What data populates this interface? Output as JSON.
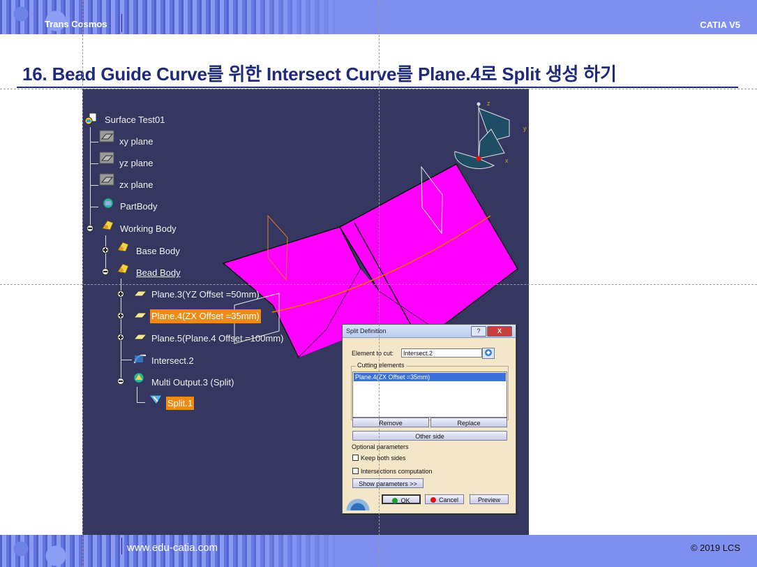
{
  "header": {
    "brand": "Trans Cosmos",
    "product": "CATIA V5"
  },
  "slide": {
    "title": "16. Bead Guide Curve를 위한 Intersect Curve를 Plane.4로 Split 생성 하기"
  },
  "footer": {
    "url": "www.edu-catia.com",
    "copyright": "© 2019 LCS"
  },
  "tree": {
    "root": "Surface Test01",
    "items": [
      {
        "label": "xy plane"
      },
      {
        "label": "yz plane"
      },
      {
        "label": "zx plane"
      },
      {
        "label": "PartBody"
      },
      {
        "label": "Working Body"
      },
      {
        "label": "Base Body"
      },
      {
        "label": "Bead Body"
      },
      {
        "label": "Plane.3(YZ Offset =50mm)"
      },
      {
        "label": "Plane.4(ZX Offset =35mm)"
      },
      {
        "label": "Plane.5(Plane.4 Offset =100mm)"
      },
      {
        "label": "Intersect.2"
      },
      {
        "label": "Multi Output.3 (Split)"
      },
      {
        "label": "Split.1"
      }
    ]
  },
  "compass": {
    "z": "z",
    "y": "y",
    "x": "x"
  },
  "colors": {
    "surface": "#ff00ff",
    "viewport": "#353761",
    "highlight": "#f08a14",
    "curve": "#ff6a00"
  },
  "dialog": {
    "title": "Split Definition",
    "help": "?",
    "close": "X",
    "element_label": "Element to cut:",
    "element_value": "Intersect.2",
    "cutting_group": "Cutting elements",
    "cutting_items": [
      "Plane.4(ZX Offset =35mm)"
    ],
    "remove": "Remove",
    "replace": "Replace",
    "other_side": "Other side",
    "optional": "Optional parameters",
    "keep_both": "Keep both sides",
    "intersections": "Intersections computation",
    "show_params": "Show parameters >>",
    "ok": "OK",
    "cancel": "Cancel",
    "preview": "Preview"
  }
}
